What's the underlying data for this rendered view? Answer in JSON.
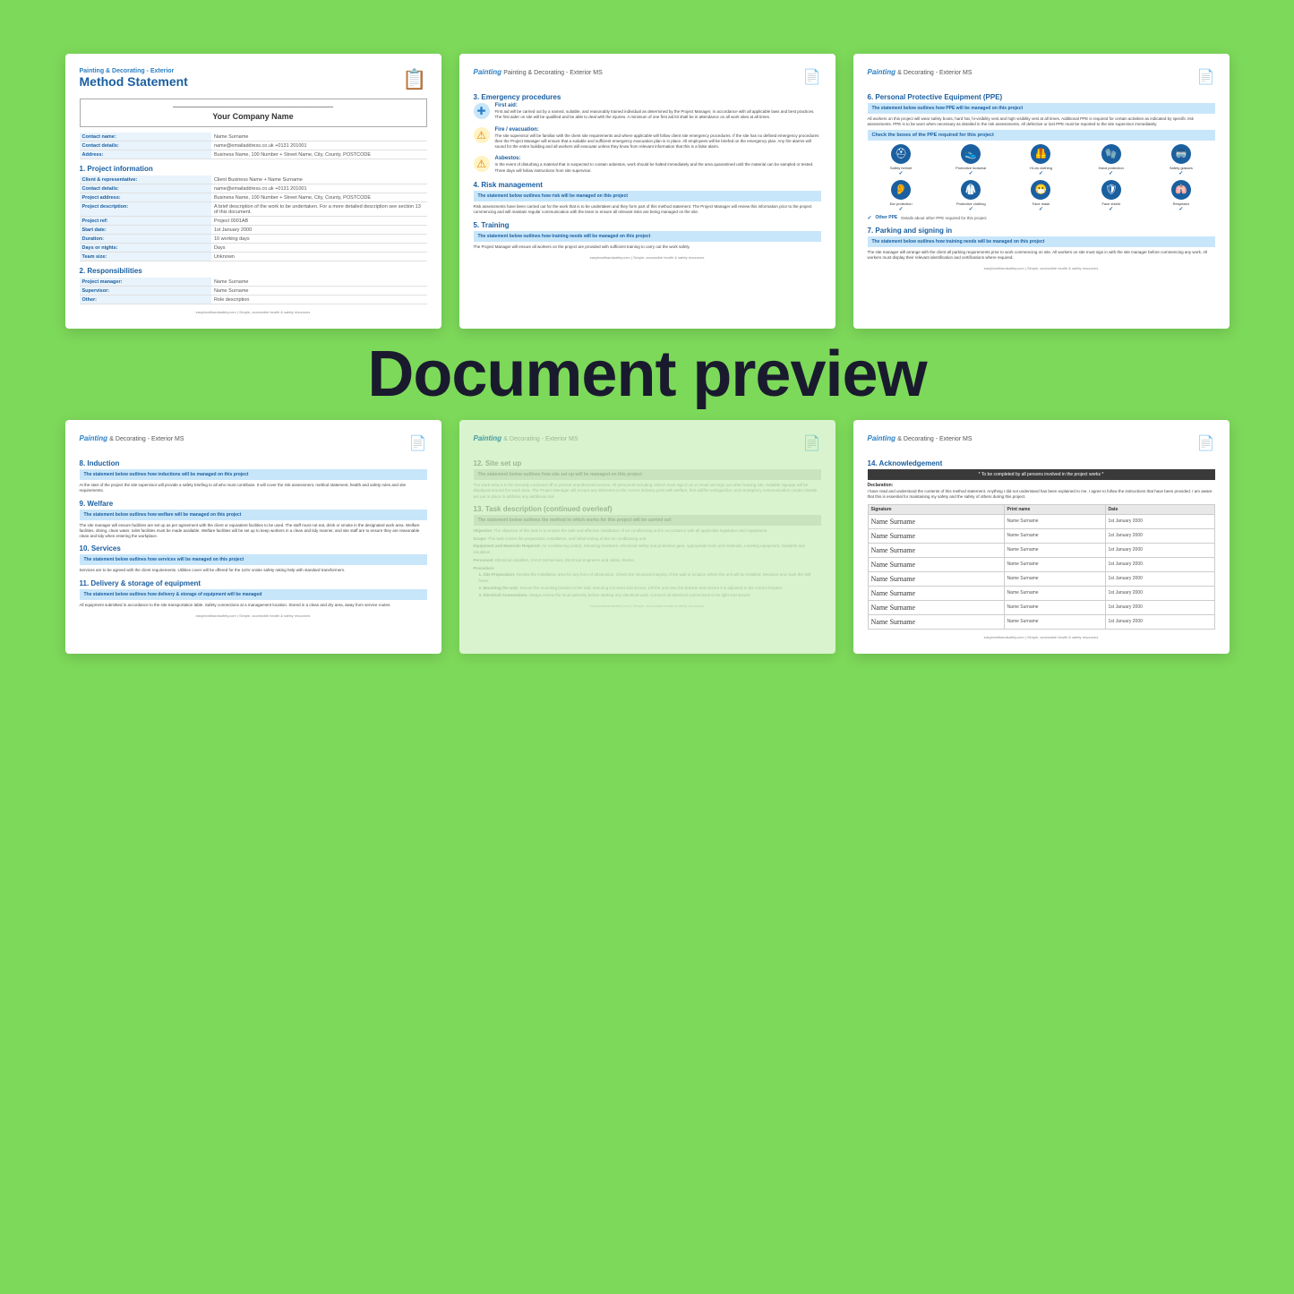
{
  "page": {
    "background_color": "#7dd95a",
    "preview_label": "Document preview"
  },
  "doc1": {
    "header_subtitle": "Painting & Decorating - Exterior",
    "header_title": "Method Statement",
    "company_name": "Your Company Name",
    "fields": [
      {
        "label": "Contact name:",
        "value": "Name Surname"
      },
      {
        "label": "Contact details:",
        "value": "name@emailaddress.co.uk  +0131 201001"
      },
      {
        "label": "Address:",
        "value": "Business Name, 100 Number + Street Name, City, County, POSTCODE"
      }
    ],
    "section1_title": "1. Project information",
    "project_fields": [
      {
        "label": "Client & representative:",
        "value": "Client Business Name + Name Surname"
      },
      {
        "label": "Contact details:",
        "value": "name@emailaddress.co.uk  +0131 201001"
      },
      {
        "label": "Project address:",
        "value": "Business Name, 100 Number + Street Name, City, County, POSTCODE"
      },
      {
        "label": "Project description:",
        "value": "A brief description of the work to be undertaken. For a more detailed description see section 13 of this document."
      },
      {
        "label": "Project ref:",
        "value": "Project 0001AB"
      },
      {
        "label": "Start date:",
        "value": "1st January 2000"
      },
      {
        "label": "Duration:",
        "value": "10 working days"
      },
      {
        "label": "Days or nights:",
        "value": "Days"
      },
      {
        "label": "Team size:",
        "value": "Unknown"
      }
    ],
    "section2_title": "2. Responsibilities",
    "responsibilities_fields": [
      {
        "label": "Project manager:",
        "value": "Name Surname"
      },
      {
        "label": "Supervisor:",
        "value": "Name Surname"
      },
      {
        "label": "Other:",
        "value": "Role description"
      }
    ],
    "footer": "easyhealthandsafety.com | Simple, accessible health & safety resources"
  },
  "doc2": {
    "header": "Painting & Decorating - Exterior MS",
    "section3_title": "3. Emergency procedures",
    "first_aid_label": "First aid:",
    "first_aid_text": "First aid will be carried out by a named, suitable, and reasonably trained individual as determined by the Project Manager, in accordance with all applicable laws and best practices. The first aider on site will be qualified and be able to deal with the injuries. A minimum of one first aid kit shall be in attendance on all work sites at all times.",
    "fire_label": "Fire / evacuation:",
    "fire_text": "The site supervisor will be familiar with the client site requirements and where applicable will follow client site emergency procedures. If the site has no defined emergency procedures then the Project Manager will ensure that a suitable and sufficient emergency evacuation plan is in place. All employees will be briefed on the emergency plan. Any fire alarms will sound for the entire building and all workers will evacuate unless they know from relevant information that this is a false alarm.",
    "asbestos_label": "Asbestos:",
    "asbestos_text": "In the event of disturbing a material that is suspected to contain asbestos, work should be halted immediately and the area quarantined until the material can be sampled or tested. Three days will follow instructions from site supervisor.",
    "section4_title": "4. Risk management",
    "risk_statement": "The statement below outlines how risk will be managed on this project",
    "risk_text": "Risk assessments have been carried out for the work that is to be undertaken and they form part of this method statement. The Project Manager will review this information prior to the project commencing and will maintain regular communication with the team to ensure all relevant risks are being managed on the site.",
    "section5_title": "5. Training",
    "training_statement": "The statement below outlines how training needs will be managed on this project",
    "training_text": "The Project Manager will ensure all workers on the project are provided with sufficient training to carry out the work safely.",
    "footer": "easyhealthandsafety.com | Simple, accessible health & safety resources"
  },
  "doc3": {
    "header": "Painting & Decorating - Exterior MS",
    "section6_title": "6. Personal Protective Equipment (PPE)",
    "ppe_statement": "The statement below outlines how PPE will be managed on this project",
    "ppe_intro": "All workers on this project will wear safety boots, hard hat, hi-visibility vest and high visibility vest at all times. Additional PPE is required for certain activities as indicated by specific risk assessments. PPE is to be worn when necessary as detailed in the risk assessments. All defective or lost PPE must be reported to the site supervisor immediately.",
    "ppe_check_label": "Check the boxes of the PPE required for this project",
    "ppe_items_row1": [
      {
        "icon": "⛑",
        "label": "Safety helmet",
        "checked": true
      },
      {
        "icon": "👟",
        "label": "Protective footwear",
        "checked": true
      },
      {
        "icon": "🦺",
        "label": "Hi-vis clothing",
        "checked": true
      },
      {
        "icon": "🧤",
        "label": "Hand protection",
        "checked": true
      },
      {
        "icon": "🥽",
        "label": "Safety glasses",
        "checked": true
      }
    ],
    "ppe_items_row2": [
      {
        "icon": "👂",
        "label": "Ear protection",
        "checked": true
      },
      {
        "icon": "🥼",
        "label": "Protective clothing",
        "checked": true
      },
      {
        "icon": "😷",
        "label": "Face mask",
        "checked": true
      },
      {
        "icon": "🛡",
        "label": "Face shield",
        "checked": true
      },
      {
        "icon": "🫁",
        "label": "Respirator",
        "checked": true
      }
    ],
    "other_ppe_label": "Other PPE",
    "other_ppe_value": "Details about other PPE required for this project",
    "section7_title": "7. Parking and signing in",
    "parking_statement": "The statement below outlines how training needs will be managed on this project",
    "parking_text": "The site manager will arrange with the client all parking requirements prior to work commencing on site. All workers on site must sign in with the site manager before commencing any work. All workers must display their relevant identification and certifications where required.",
    "footer": "easyhealthandsafety.com | Simple, accessible health & safety resources"
  },
  "doc4": {
    "header": "Painting & Decorating - Exterior MS",
    "section8_title": "8. Induction",
    "induction_statement": "The statement below outlines how inductions will be managed on this project",
    "induction_text": "At the start of the project the site supervisor will provide a safety briefing to all who must contribute. It will cover the risk assessment, method statement, health and safety rules and site requirements.",
    "section9_title": "9. Welfare",
    "welfare_statement": "The statement below outlines how welfare will be managed on this project",
    "welfare_text": "The site manager will ensure facilities are set up as per agreement with the client or equivalent facilities to be used. The staff must not eat, drink or smoke in the designated work area. Welfare facilities, dining, clean water, toilet facilities must be made available. Welfare facilities will be set up to keep workers in a clean and tidy manner, and site staff are to ensure they are reasonable clean and tidy when entering the workplace.",
    "section10_title": "10. Services",
    "services_statement": "The statement below outlines how services will be managed on this project",
    "services_text": "Services are to be agreed with the client requirements. Utilities cover will be offered for the 110V onsite safety raking help with standard transformers.",
    "section11_title": "11. Delivery & storage of equipment",
    "delivery_statement": "The statement below outlines how delivery & storage of equipment will be managed",
    "delivery_text": "All equipment submitted in accordance to the site transportation table. Safety connections at a management location. Stored in a clean and dry area, away from service routes.",
    "footer": "easyhealthandsafety.com | Simple, accessible health & safety resources"
  },
  "doc5": {
    "header": "Painting & Decorating - Exterior MS",
    "section12_title": "12. Site set up",
    "setup_statement": "The statement below outlines how site set up will be managed on this project",
    "setup_text": "The work area is to be securely cordoned off to prevent unauthorised access. All personnel including visitors must sign in at or email and sign out when leaving site. Suitable signage will be displayed around the work area. The Project Manager will ensure any deliveries to the correct delivery point with welfare, first aid/fire extinguisher, and emergency communication contact details are put in place to address any additional risk.",
    "section13_title": "13. Task description (continued overleaf)",
    "task_statement": "The statement below outlines the method in which works for this project will be carried out",
    "task_sections": [
      {
        "heading": "Objective:",
        "text": "The objective of this task is to ensure the safe and effective installation of air conditioning unit in accordance with all applicable legislation and regulations."
      },
      {
        "heading": "Scope:",
        "text": "This task covers the preparation, installation, and initial testing of the air conditioning unit. It is applicable to both residential and light commercial settings."
      },
      {
        "heading": "Equipment and Materials Required:",
        "text": "Air conditioning unit(s), Mounting hardware, Electrical safety and protective gear, Appropriate tools and materials, Leveling equipment, Sealants and insulation"
      },
      {
        "heading": "Personnel:",
        "text": "Electrical installers, HVAC technicians, Electrical engineers and safety checks"
      },
      {
        "heading": "Procedure:",
        "subprocedures": [
          {
            "num": "1.",
            "title": "Site Preparation:",
            "text": "Review the installation area for any form of obstruction. Check the structural integrity of the wall or location where the unit will be installed. Measure and mark the drill holes for the bracket and drain the pipe will be installed."
          },
          {
            "num": "2.",
            "title": "Mounting the Unit:",
            "text": "Secure the mounting bracket to the wall, ensuring it is level and secure. Lift the unit onto the bracket and ensure it is adjusted to the correct bracket. Connect the drain pipe to an appropriate and agreed to the correct bracket."
          },
          {
            "num": "3.",
            "title": "Electrical Connections:",
            "text": "Always review the local authority before starting any electrical work. Connect all electrical connections to be light and secure. Turn off the outlet cable making sure electrical works complete. Lift the unit with the help of an assistant and place it onto the nearest bracket."
          }
        ]
      }
    ],
    "footer": "easyhealthandsafety.com | Simple, accessible health & safety resources"
  },
  "doc6": {
    "header": "Painting & Decorating - Exterior MS",
    "section14_title": "14. Acknowledgement",
    "complete_note": "* To be completed by all persons involved in the project works *",
    "declaration_label": "Declaration:",
    "declaration_text": "I have read and understood the contents of this method statement. Anything I did not understand has been explained to me. I agree to follow the instructions that have been provided. I am aware that this is essential for maintaining my safety and the safety of others during this project.",
    "table_headers": [
      "Signature",
      "Print name",
      "Date"
    ],
    "signatures": [
      {
        "sig": "Name Surname",
        "print": "Name Surname",
        "date": "1st January 2000"
      },
      {
        "sig": "Name Surname",
        "print": "Name Surname",
        "date": "1st January 2000"
      },
      {
        "sig": "Name Surname",
        "print": "Name Surname",
        "date": "1st January 2000"
      },
      {
        "sig": "Name Surname",
        "print": "Name Surname",
        "date": "1st January 2000"
      },
      {
        "sig": "Name Surname",
        "print": "Name Surname",
        "date": "1st January 2000"
      },
      {
        "sig": "Name Surname",
        "print": "Name Surname",
        "date": "1st January 2000"
      },
      {
        "sig": "Name Surname",
        "print": "Name Surname",
        "date": "1st January 2000"
      },
      {
        "sig": "Name Surname",
        "print": "Name Surname",
        "date": "1st January 2000"
      }
    ],
    "footer": "easyhealthandsafety.com | Simple, accessible health & safety resources"
  }
}
